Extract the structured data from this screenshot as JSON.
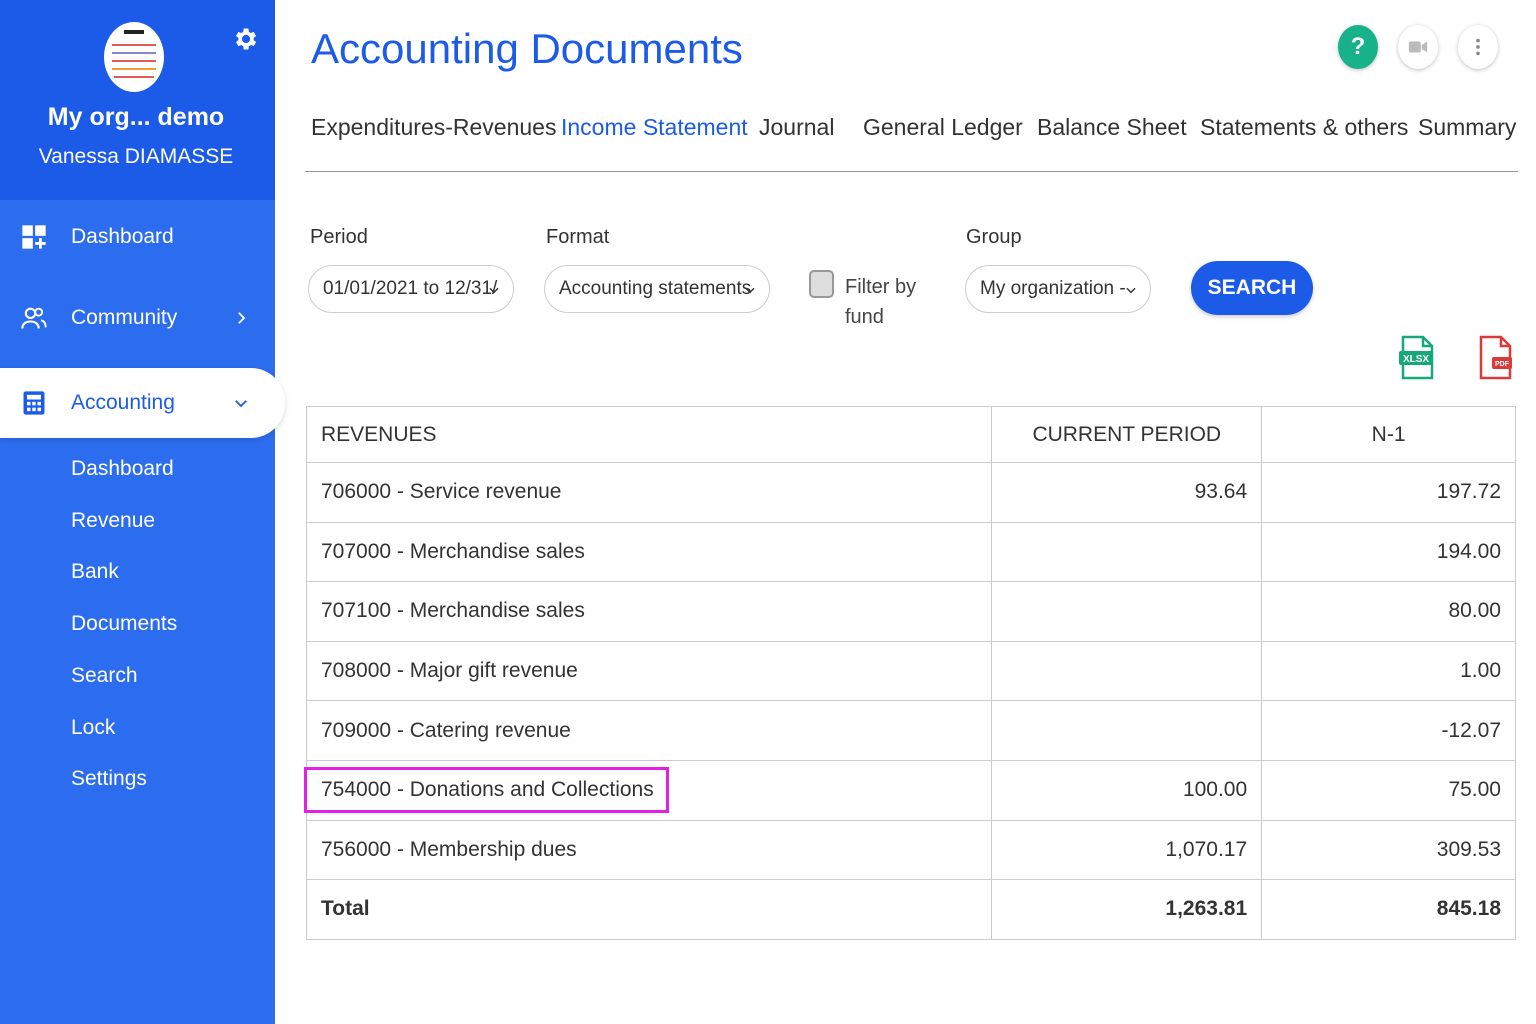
{
  "sidebar": {
    "org_name": "My org... demo",
    "user_name": "Vanessa DIAMASSE",
    "nav": [
      {
        "label": "Dashboard",
        "icon": "dashboard-icon"
      },
      {
        "label": "Community",
        "icon": "community-icon"
      },
      {
        "label": "Accounting",
        "icon": "calculator-icon"
      }
    ],
    "accounting_sub": [
      "Dashboard",
      "Revenue",
      "Bank",
      "Documents",
      "Search",
      "Lock",
      "Settings"
    ]
  },
  "header": {
    "title": "Accounting Documents",
    "help_label": "?"
  },
  "tabs": [
    "Expenditures-Revenues",
    "Income Statement",
    "Journal",
    "General Ledger",
    "Balance Sheet",
    "Statements & others",
    "Summary"
  ],
  "filters": {
    "period_label": "Period",
    "period_value": "01/01/2021 to 12/31/",
    "format_label": "Format",
    "format_value": "Accounting statements",
    "filter_by_fund_line1": "Filter by",
    "filter_by_fund_line2": "fund",
    "group_label": "Group",
    "group_value": "My organization -",
    "search_label": "SEARCH"
  },
  "exports": {
    "xlsx_label": "XLSX",
    "pdf_label": "PDF"
  },
  "table": {
    "headers": [
      "REVENUES",
      "CURRENT PERIOD",
      "N-1"
    ],
    "rows": [
      {
        "account": "706000 - Service revenue",
        "current": "93.64",
        "previous": "197.72"
      },
      {
        "account": "707000 - Merchandise sales",
        "current": "",
        "previous": "194.00"
      },
      {
        "account": "707100 - Merchandise sales",
        "current": "",
        "previous": "80.00"
      },
      {
        "account": "708000 - Major gift revenue",
        "current": "",
        "previous": "1.00"
      },
      {
        "account": "709000 - Catering revenue",
        "current": "",
        "previous": "-12.07"
      },
      {
        "account": "754000 - Donations and Collections",
        "current": "100.00",
        "previous": "75.00"
      },
      {
        "account": "756000 - Membership dues",
        "current": "1,070.17",
        "previous": "309.53"
      }
    ],
    "total": {
      "label": "Total",
      "current": "1,263.81",
      "previous": "845.18"
    }
  },
  "colors": {
    "primary": "#1c5be8",
    "sidebar": "#2c6df0",
    "highlight": "#e51fe5",
    "help": "#17b18a",
    "xlsx": "#17a878",
    "pdf": "#d93a3a"
  }
}
